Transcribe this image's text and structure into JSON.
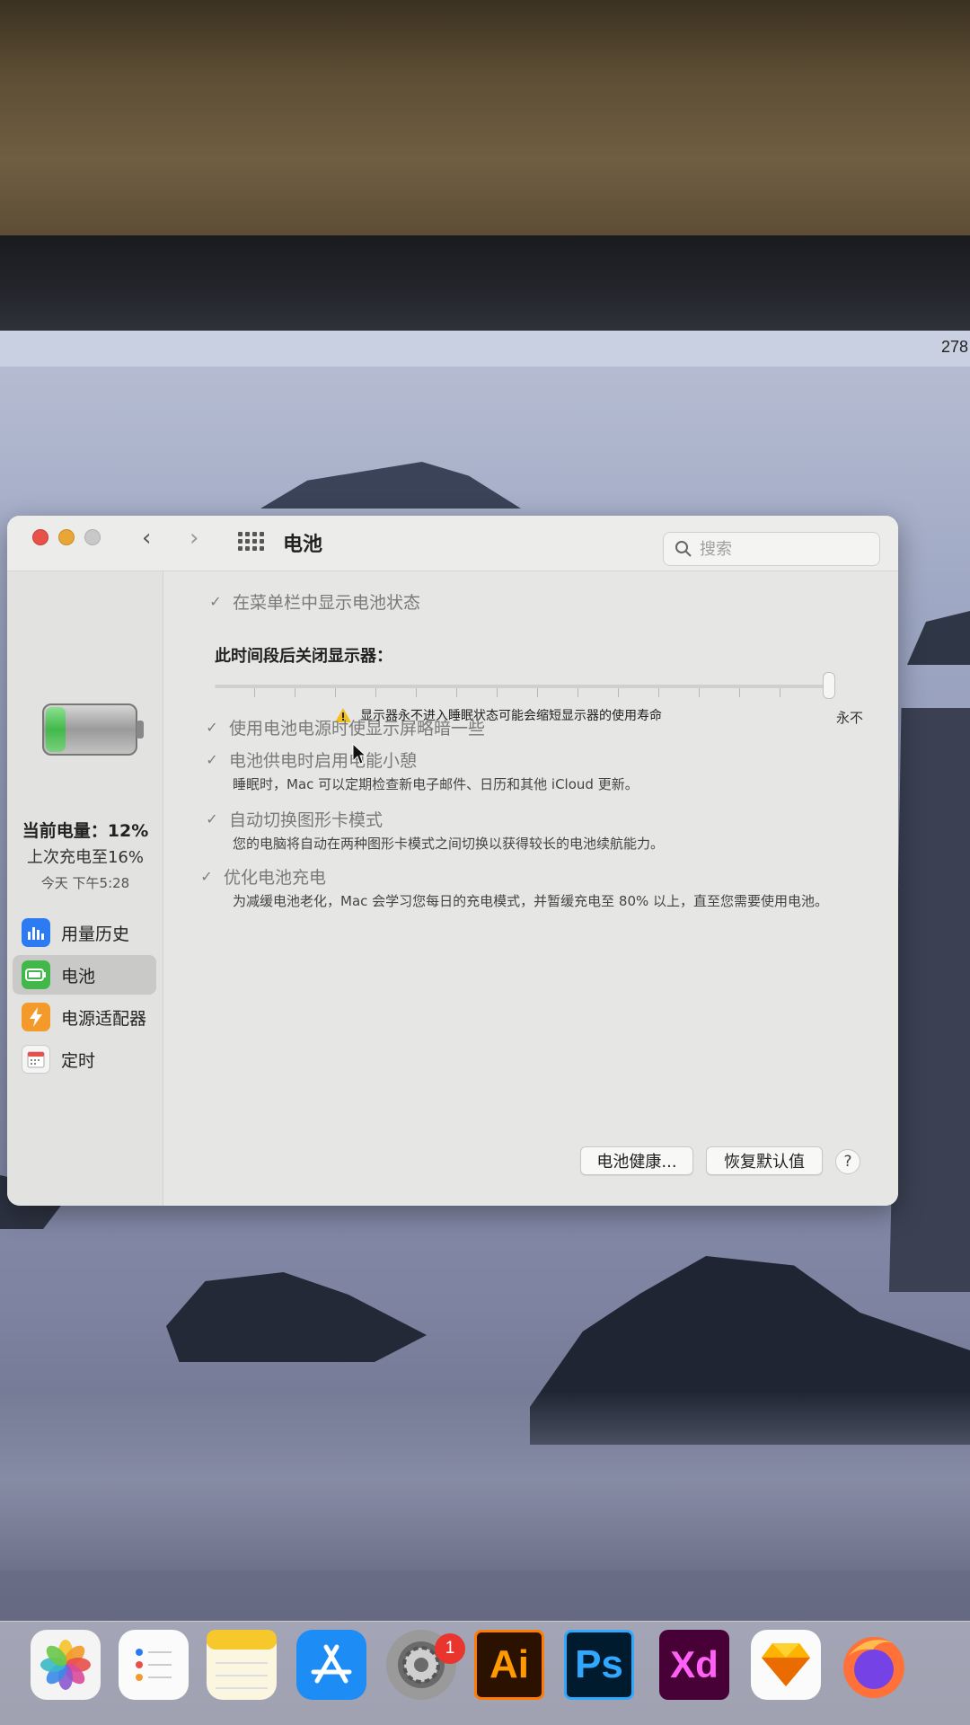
{
  "menubar": {
    "right_text": "278"
  },
  "window": {
    "title": "电池",
    "search_placeholder": "搜索"
  },
  "sidebar": {
    "battery_level": "当前电量：12%",
    "last_charged": "上次充电至16%",
    "last_charged_time": "今天 下午5:28",
    "items": [
      {
        "label": "用量历史",
        "icon": "bar-chart-icon"
      },
      {
        "label": "电池",
        "icon": "battery-icon",
        "active": true
      },
      {
        "label": "电源适配器",
        "icon": "bolt-icon"
      },
      {
        "label": "定时",
        "icon": "calendar-icon"
      }
    ]
  },
  "main": {
    "show_in_menubar": "在菜单栏中显示电池状态",
    "display_off_title": "此时间段后关闭显示器：",
    "slider_end_label": "永不",
    "warning_text": "显示器永不进入睡眠状态可能会缩短显示器的使用寿命",
    "options": [
      {
        "label": "使用电池电源时使显示屏略暗一些",
        "desc": ""
      },
      {
        "label": "电池供电时启用电能小憩",
        "desc": "睡眠时，Mac 可以定期检查新电子邮件、日历和其他 iCloud 更新。"
      },
      {
        "label": "自动切换图形卡模式",
        "desc": "您的电脑将自动在两种图形卡模式之间切换以获得较长的电池续航能力。"
      },
      {
        "label": "优化电池充电",
        "desc": "为减缓电池老化，Mac 会学习您每日的充电模式，并暂缓充电至 80% 以上，直至您需要使用电池。"
      }
    ],
    "battery_health_button": "电池健康...",
    "restore_defaults_button": "恢复默认值",
    "help_button": "?"
  },
  "dock": {
    "settings_badge": "1",
    "illustrator_label": "Ai",
    "photoshop_label": "Ps",
    "xd_label": "Xd"
  },
  "colors": {
    "battery_green": "#42b84a",
    "warning_yellow": "#f2c019",
    "close_red": "#e8504a"
  }
}
